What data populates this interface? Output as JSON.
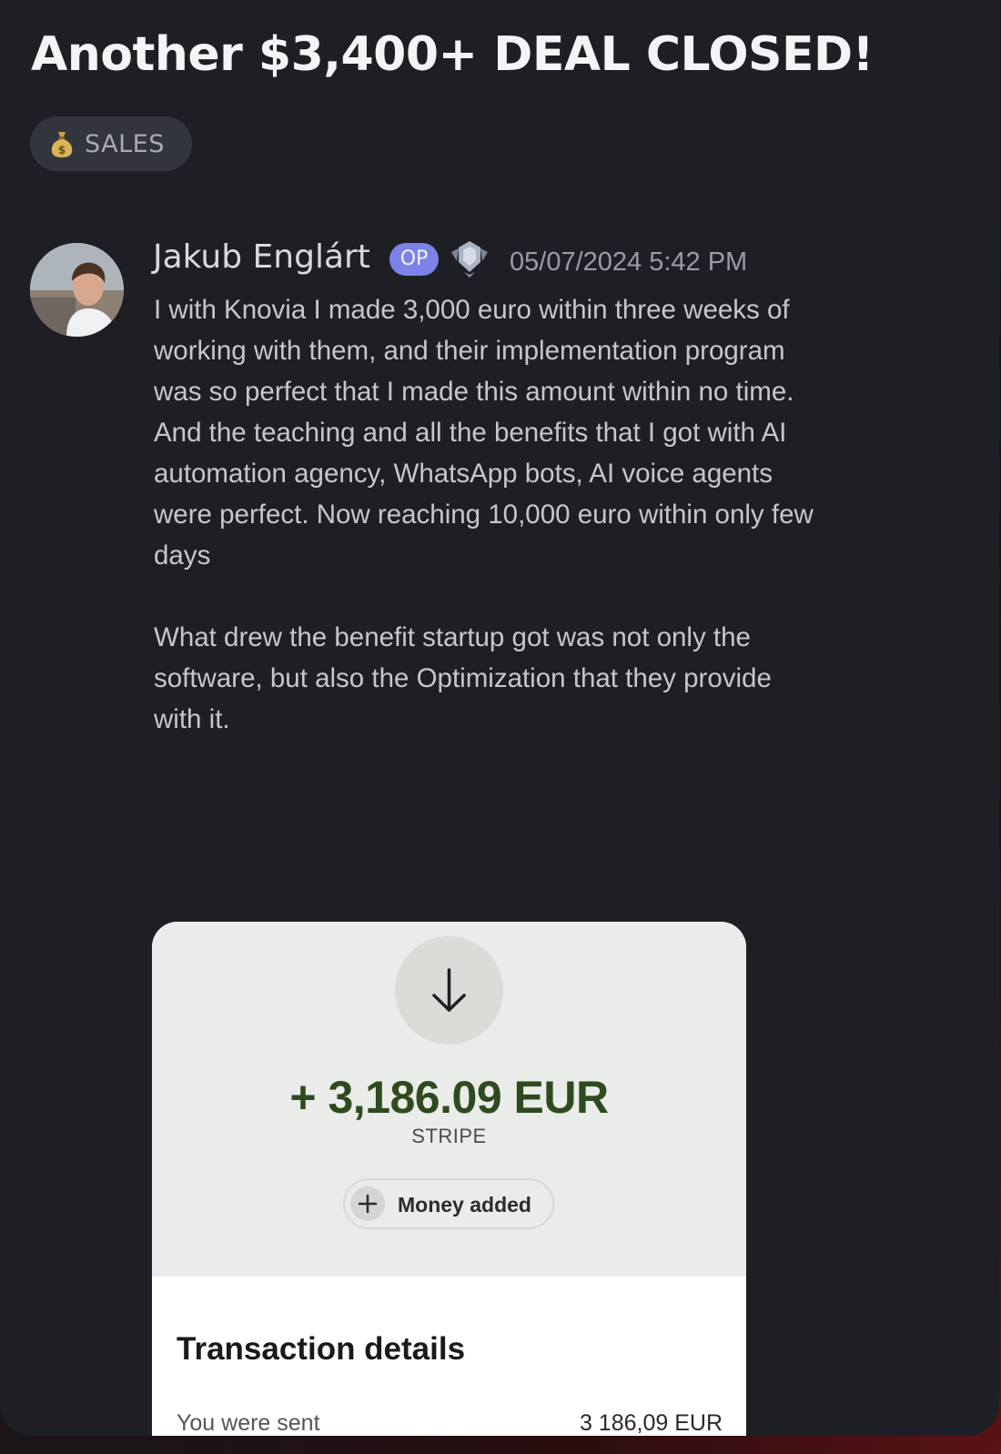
{
  "thread": {
    "title": "Another $3,400+ DEAL CLOSED!",
    "tag": {
      "icon": "money-bag-icon",
      "label": "SALES"
    }
  },
  "post": {
    "author": "Jakub Englárt",
    "badge": "OP",
    "rank_icon": "rank-emblem-icon",
    "timestamp": "05/07/2024 5:42 PM",
    "paragraphs": [
      "I with Knovia I made 3,000 euro within three weeks of\nworking with them, and their implementation program\nwas so perfect that I made this amount within no time.\nAnd the teaching and all the benefits that I got with AI\nautomation agency, WhatsApp bots, AI voice agents\nwere perfect. Now reaching 10,000 euro within only few\ndays",
      "What drew the benefit startup got was not only the\nsoftware, but also the Optimization that they provide\nwith it."
    ]
  },
  "attachment": {
    "icon": "arrow-down-icon",
    "amount": "+ 3,186.09 EUR",
    "source": "STRIPE",
    "status_icon": "plus-icon",
    "status_label": "Money added",
    "details_title": "Transaction details",
    "rows": [
      {
        "label": "You were sent",
        "value": "3 186,09 EUR"
      }
    ]
  },
  "colors": {
    "panel_bg": "#1e1f25",
    "op_badge": "#7b83e8",
    "amount_green": "#2f4a1f",
    "receipt_top": "#e9ece8"
  }
}
